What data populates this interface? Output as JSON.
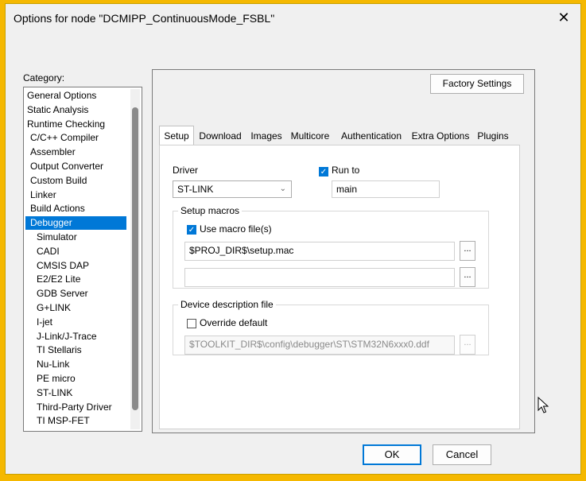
{
  "window": {
    "title": "Options for node \"DCMIPP_ContinuousMode_FSBL\"",
    "close_glyph": "✕"
  },
  "category": {
    "label": "Category:",
    "items": [
      {
        "label": "General Options",
        "indent": false,
        "selected": false
      },
      {
        "label": "Static Analysis",
        "indent": false,
        "selected": false
      },
      {
        "label": "Runtime Checking",
        "indent": false,
        "selected": false
      },
      {
        "label": "C/C++ Compiler",
        "indent": true,
        "selected": false
      },
      {
        "label": "Assembler",
        "indent": true,
        "selected": false
      },
      {
        "label": "Output Converter",
        "indent": true,
        "selected": false
      },
      {
        "label": "Custom Build",
        "indent": true,
        "selected": false
      },
      {
        "label": "Linker",
        "indent": true,
        "selected": false
      },
      {
        "label": "Build Actions",
        "indent": true,
        "selected": false
      },
      {
        "label": "Debugger",
        "indent": true,
        "selected": true
      },
      {
        "label": "Simulator",
        "indent": true,
        "deep": true,
        "selected": false
      },
      {
        "label": "CADI",
        "indent": true,
        "deep": true,
        "selected": false
      },
      {
        "label": "CMSIS DAP",
        "indent": true,
        "deep": true,
        "selected": false
      },
      {
        "label": "E2/E2 Lite",
        "indent": true,
        "deep": true,
        "selected": false
      },
      {
        "label": "GDB Server",
        "indent": true,
        "deep": true,
        "selected": false
      },
      {
        "label": "G+LINK",
        "indent": true,
        "deep": true,
        "selected": false
      },
      {
        "label": "I-jet",
        "indent": true,
        "deep": true,
        "selected": false
      },
      {
        "label": "J-Link/J-Trace",
        "indent": true,
        "deep": true,
        "selected": false
      },
      {
        "label": "TI Stellaris",
        "indent": true,
        "deep": true,
        "selected": false
      },
      {
        "label": "Nu-Link",
        "indent": true,
        "deep": true,
        "selected": false
      },
      {
        "label": "PE micro",
        "indent": true,
        "deep": true,
        "selected": false
      },
      {
        "label": "ST-LINK",
        "indent": true,
        "deep": true,
        "selected": false
      },
      {
        "label": "Third-Party Driver",
        "indent": true,
        "deep": true,
        "selected": false
      },
      {
        "label": "TI MSP-FET",
        "indent": true,
        "deep": true,
        "selected": false
      }
    ]
  },
  "factory_settings": "Factory Settings",
  "tabs": [
    "Setup",
    "Download",
    "Images",
    "Multicore",
    "Authentication",
    "Extra Options",
    "Plugins"
  ],
  "active_tab": "Setup",
  "setup": {
    "driver_label": "Driver",
    "driver_value": "ST-LINK",
    "run_to_label": "Run to",
    "run_to_checked": true,
    "run_to_value": "main",
    "setup_macros": {
      "title": "Setup macros",
      "use_macro_label": "Use macro file(s)",
      "use_macro_checked": true,
      "macro_file_1": "$PROJ_DIR$\\setup.mac",
      "macro_file_2": "",
      "browse": "..."
    },
    "device_desc": {
      "title": "Device description file",
      "override_label": "Override default",
      "override_checked": false,
      "file": "$TOOLKIT_DIR$\\config\\debugger\\ST\\STM32N6xxx0.ddf",
      "browse": "..."
    }
  },
  "buttons": {
    "ok": "OK",
    "cancel": "Cancel"
  }
}
